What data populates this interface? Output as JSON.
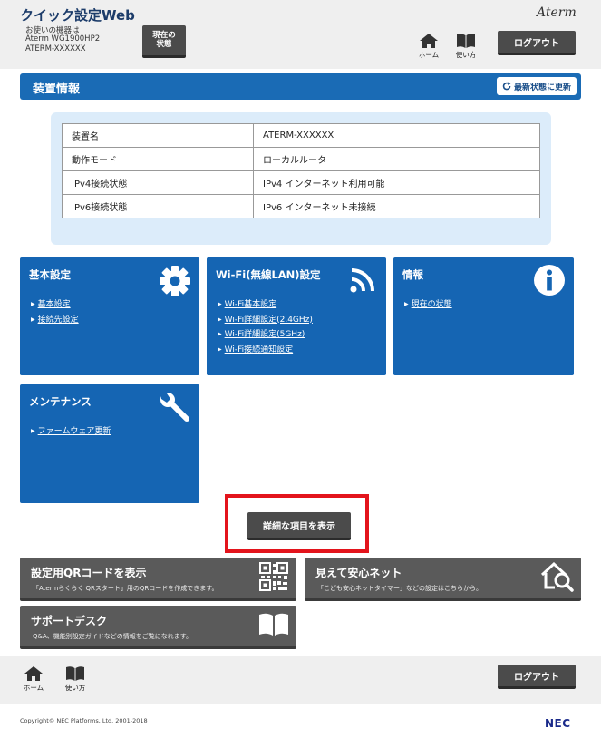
{
  "header": {
    "app_title": "クイック設定Web",
    "device_line1": "お使いの機器は",
    "device_line2": "Aterm WG1900HP2",
    "device_line3": "ATERM-XXXXXX",
    "status_button": "現在の\n状態",
    "brand": "Aterm",
    "home_label": "ホーム",
    "manual_label": "使い方",
    "logout_label": "ログアウト"
  },
  "device_info": {
    "title": "装置情報",
    "refresh_label": "最新状態に更新",
    "rows": [
      {
        "key": "装置名",
        "value": "ATERM-XXXXXX"
      },
      {
        "key": "動作モード",
        "value": "ローカルルータ"
      },
      {
        "key": "IPv4接続状態",
        "value": "IPv4 インターネット利用可能"
      },
      {
        "key": "IPv6接続状態",
        "value": "IPv6 インターネット未接続"
      }
    ]
  },
  "tiles": {
    "basic": {
      "title": "基本設定",
      "links": [
        "基本設定",
        "接続先設定"
      ]
    },
    "wifi": {
      "title": "Wi-Fi(無線LAN)設定",
      "links": [
        "Wi-Fi基本設定",
        "Wi-Fi詳細設定(2.4GHz)",
        "Wi-Fi詳細設定(5GHz)",
        "Wi-Fi接続通知設定"
      ]
    },
    "info": {
      "title": "情報",
      "links": [
        "現在の状態"
      ]
    },
    "maintenance": {
      "title": "メンテナンス",
      "links": [
        "ファームウェア更新"
      ]
    }
  },
  "details_button": "詳細な項目を表示",
  "banners": {
    "qr": {
      "title": "設定用QRコードを表示",
      "subtitle": "「Atermらくらく QRスタート」用のQRコードを作成できます。"
    },
    "safe_net": {
      "title": "見えて安心ネット",
      "subtitle": "「こども安心ネットタイマー」などの設定はこちらから。"
    },
    "support": {
      "title": "サポートデスク",
      "subtitle": "Q&A、機能別設定ガイドなどの情報をご覧になれます。"
    }
  },
  "footer": {
    "home_label": "ホーム",
    "manual_label": "使い方",
    "logout_label": "ログアウト",
    "copyright": "Copyright© NEC Platforms, Ltd. 2001-2018",
    "logo": "NEC"
  },
  "colors": {
    "tile_blue": "#1565b3",
    "header_blue": "#1a6bb5",
    "panel_light_blue": "#dcecfa",
    "dark_button": "#4b4b4b",
    "banner_gray": "#5a5a5a",
    "highlight_red": "#e3141c"
  },
  "icons": [
    "home-icon",
    "book-icon",
    "refresh-icon",
    "gear-icon",
    "wifi-icon",
    "info-icon",
    "wrench-icon",
    "qr-code-icon",
    "house-search-icon",
    "open-book-icon"
  ]
}
